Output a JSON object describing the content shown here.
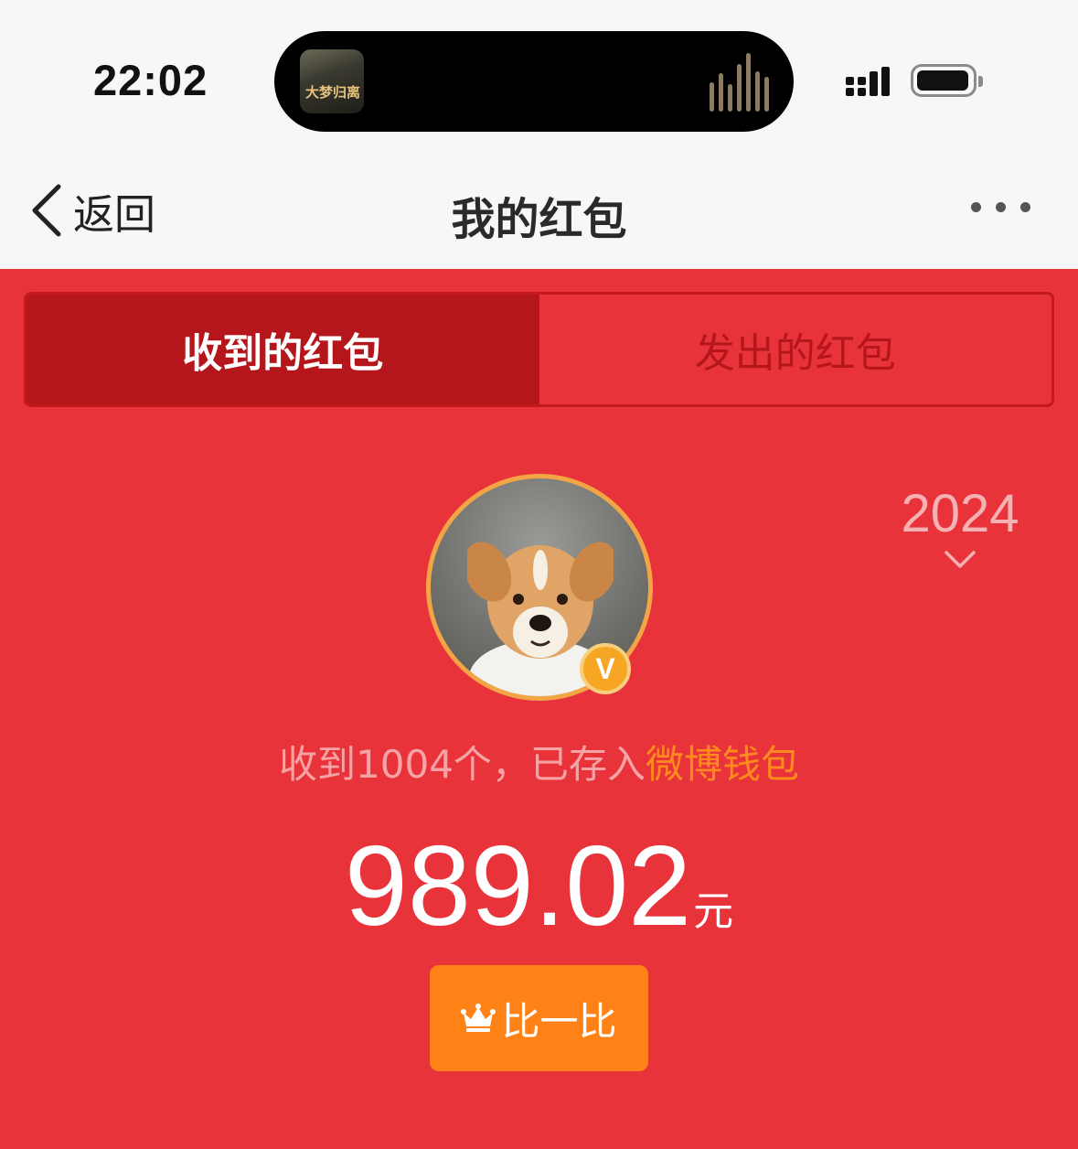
{
  "status_bar": {
    "time": "22:02",
    "now_playing_art_text": "大梦归离",
    "icons": [
      "now-playing-art",
      "audio-waveform-icon",
      "cellular-signal-icon",
      "battery-icon"
    ]
  },
  "nav": {
    "back_label": "返回",
    "title": "我的红包",
    "more_icon": "ellipsis-icon"
  },
  "tabs": [
    {
      "label": "收到的红包",
      "active": true
    },
    {
      "label": "发出的红包",
      "active": false
    }
  ],
  "year_selector": {
    "value": "2024",
    "icon": "chevron-down-icon"
  },
  "profile": {
    "verified_badge": "V"
  },
  "summary": {
    "prefix": "收到1004个，已存入",
    "wallet_link": "微博钱包"
  },
  "amount": {
    "value": "989.02",
    "unit": "元"
  },
  "compare_button": {
    "label": "比一比",
    "icon": "crown-icon"
  },
  "colors": {
    "background_red": "#e8333b",
    "tab_active": "#b5161b",
    "accent_orange": "#ff8217",
    "link_orange": "#ff8a1e",
    "avatar_ring": "#f3a545"
  }
}
